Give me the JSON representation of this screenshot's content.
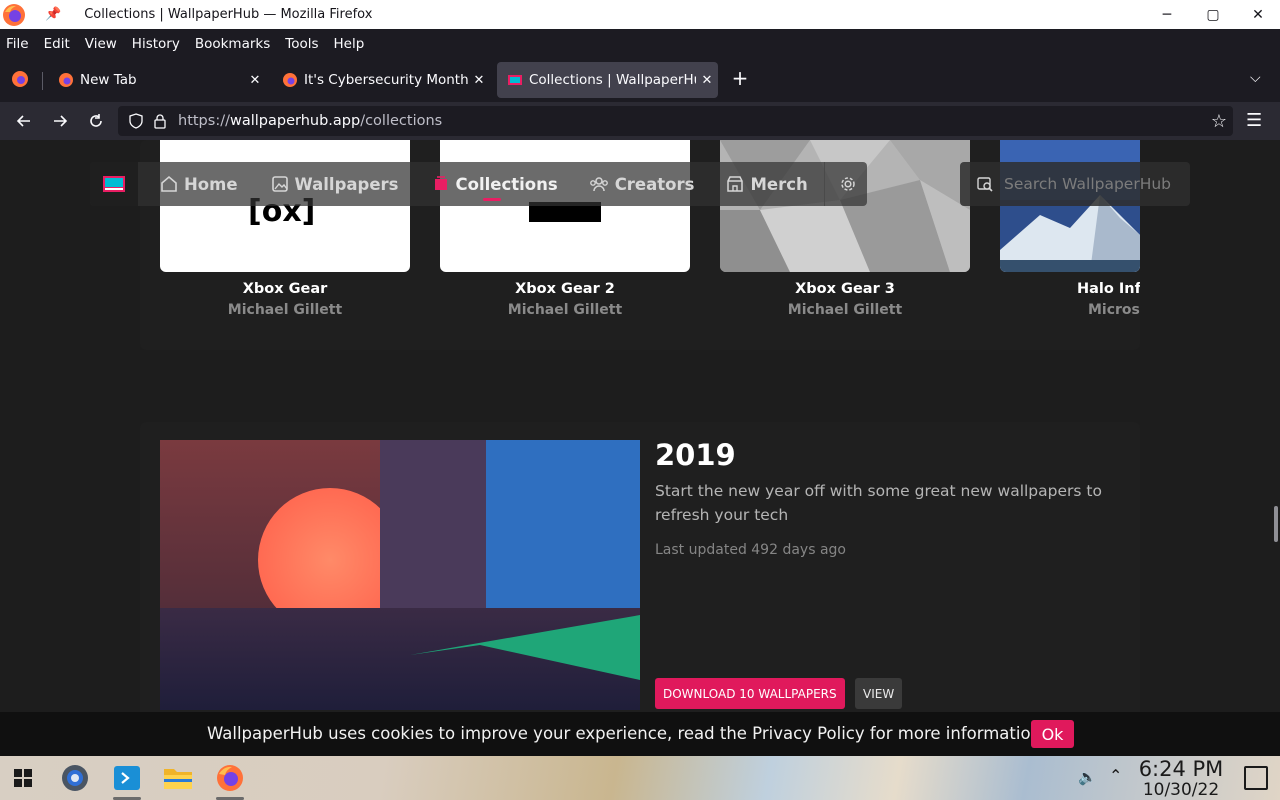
{
  "window": {
    "title": "Collections | WallpaperHub — Mozilla Firefox",
    "controls": {
      "minimize": "─",
      "maximize": "▢",
      "close": "✕"
    }
  },
  "menubar": [
    "File",
    "Edit",
    "View",
    "History",
    "Bookmarks",
    "Tools",
    "Help"
  ],
  "tabs": [
    {
      "label": "New Tab",
      "active": false
    },
    {
      "label": "It's Cybersecurity Month — ",
      "active": false
    },
    {
      "label": "Collections | WallpaperHub",
      "active": true
    }
  ],
  "urlbar": {
    "scheme": "https://",
    "host": "wallpaperhub.app",
    "path": "/collections"
  },
  "site_nav": {
    "items": [
      "Home",
      "Wallpapers",
      "Collections",
      "Creators",
      "Merch"
    ],
    "active": "Collections",
    "search_placeholder": "Search WallpaperHub"
  },
  "cards": [
    {
      "title": "Xbox Gear",
      "author": "Michael Gillett",
      "image_text": "[ox]"
    },
    {
      "title": "Xbox Gear 2",
      "author": "Michael Gillett"
    },
    {
      "title": "Xbox Gear 3",
      "author": "Michael Gillett"
    },
    {
      "title": "Halo Infi",
      "author": "Micros"
    }
  ],
  "collection": {
    "title": "2019",
    "description": "Start the new year off with some great new wallpapers to refresh your tech",
    "updated": "Last updated 492 days ago",
    "download_label": "DOWNLOAD 10 WALLPAPERS",
    "view_label": "VIEW"
  },
  "cookie": {
    "text": "WallpaperHub uses cookies to improve your experience, read the Privacy Policy for more information",
    "ok_label": "Ok"
  },
  "taskbar": {
    "time": "6:24 PM",
    "date": "10/30/22"
  },
  "colors": {
    "accent": "#e0195c",
    "page_bg": "#1d1d1d",
    "browser_bg": "#1c1b22"
  }
}
